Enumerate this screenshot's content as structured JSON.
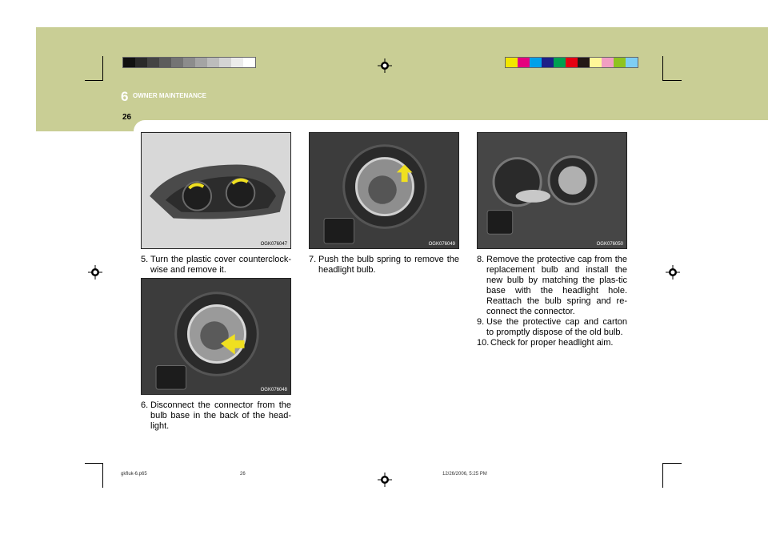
{
  "header": {
    "section_number": "6",
    "section_title": "OWNER MAINTENANCE",
    "page_number": "26"
  },
  "colors": {
    "band": "#c9ce95",
    "arrow": "#f0e020"
  },
  "color_bar_left": [
    "#111111",
    "#2a2a2a",
    "#444444",
    "#5c5c5c",
    "#747474",
    "#8c8c8c",
    "#a4a4a4",
    "#bcbcbc",
    "#d4d4d4",
    "#ececec",
    "#ffffff"
  ],
  "color_bar_right": [
    "#f2e600",
    "#e6007e",
    "#00a0e9",
    "#1d2088",
    "#00a051",
    "#e60012",
    "#231815",
    "#fff799",
    "#f19ec2",
    "#8fc31f",
    "#7ecef4"
  ],
  "figures": [
    {
      "code": "OGK076047",
      "icon": "headlight-assembly-photo"
    },
    {
      "code": "OGK076048",
      "icon": "connector-disconnect-photo"
    },
    {
      "code": "OGK076049",
      "icon": "bulb-spring-photo"
    },
    {
      "code": "OGK076050",
      "icon": "bulb-removed-photo"
    }
  ],
  "steps": [
    {
      "number": "5.",
      "text": "Turn the plastic cover counterclock-wise and remove it."
    },
    {
      "number": "6.",
      "text": "Disconnect the connector from the bulb base in the back of the head-light."
    },
    {
      "number": "7.",
      "text": "Push the bulb spring to remove the headlight bulb."
    },
    {
      "number": "8.",
      "text": "Remove the protective cap from the replacement bulb and install the new bulb by matching the plas-tic base with the headlight hole. Reattach the bulb spring and re-connect the connector."
    },
    {
      "number": "9.",
      "text": "Use the protective cap and carton to promptly dispose of the old bulb."
    },
    {
      "number": "10.",
      "text": "Check for proper headlight aim."
    }
  ],
  "footer": {
    "file": "gkfluk-6.p65",
    "page": "26",
    "timestamp": "12/26/2006, 5:25 PM"
  }
}
